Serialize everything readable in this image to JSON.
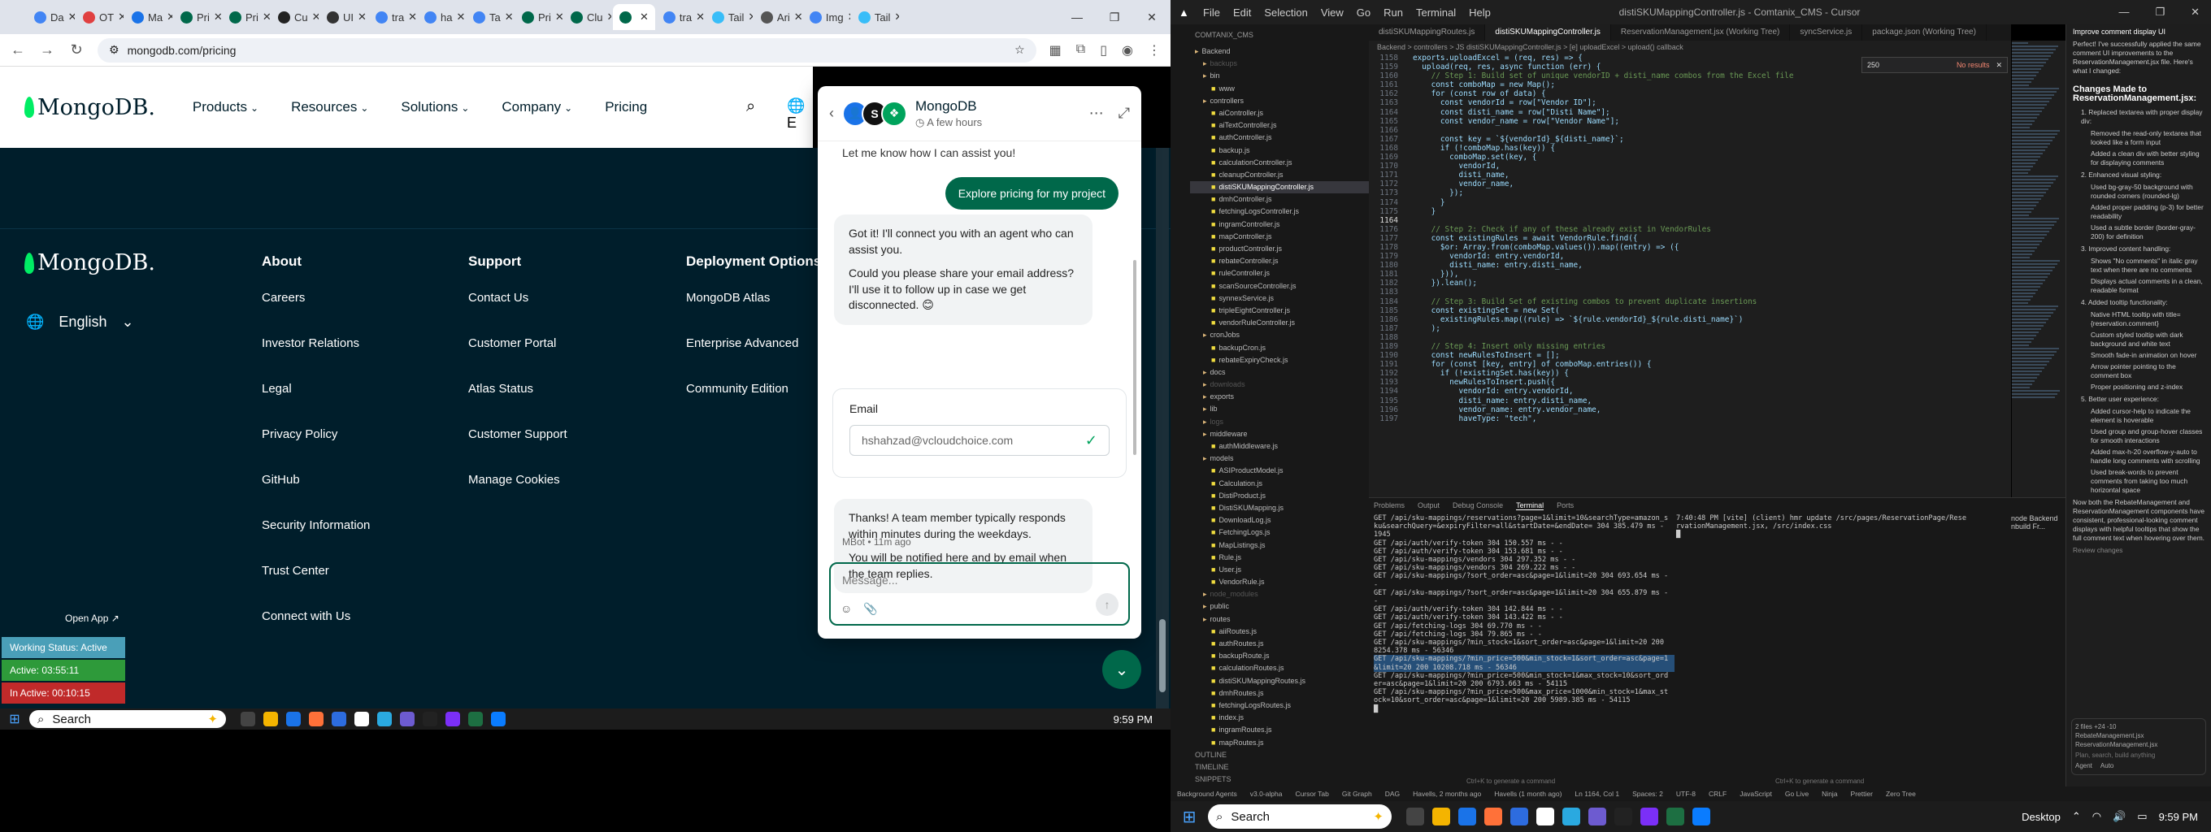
{
  "browser": {
    "tabs": [
      {
        "label": "Da",
        "color": "#4285f4"
      },
      {
        "label": "OT",
        "color": "#e04040"
      },
      {
        "label": "Ma",
        "color": "#1a73e8"
      },
      {
        "label": "Pri",
        "color": "#00684a"
      },
      {
        "label": "Pri",
        "color": "#00684a"
      },
      {
        "label": "Cu",
        "color": "#222222"
      },
      {
        "label": "UI",
        "color": "#333333"
      },
      {
        "label": "tra",
        "color": "#4285f4"
      },
      {
        "label": "ha",
        "color": "#4285f4"
      },
      {
        "label": "Ta",
        "color": "#4285f4"
      },
      {
        "label": "Pri",
        "color": "#00684a"
      },
      {
        "label": "Clu",
        "color": "#00684a"
      },
      {
        "label": "",
        "color": "#00684a"
      },
      {
        "label": "tra",
        "color": "#4285f4"
      },
      {
        "label": "Tail",
        "color": "#38bdf8"
      },
      {
        "label": "Ari",
        "color": "#555555"
      },
      {
        "label": "Img",
        "color": "#4285f4"
      },
      {
        "label": "Tail",
        "color": "#38bdf8"
      }
    ],
    "url": "mongodb.com/pricing"
  },
  "site": {
    "logo": "MongoDB.",
    "nav": [
      "Products",
      "Resources",
      "Solutions",
      "Company",
      "Pricing"
    ],
    "nav_lang": "E",
    "footer_lang": "English",
    "columns": [
      {
        "title": "About",
        "items": [
          "Careers",
          "Investor Relations",
          "Legal",
          "Privacy Policy",
          "GitHub",
          "Security Information",
          "Trust Center",
          "Connect with Us"
        ]
      },
      {
        "title": "Support",
        "items": [
          "Contact Us",
          "Customer Portal",
          "Atlas Status",
          "Customer Support",
          "Manage Cookies"
        ]
      },
      {
        "title": "Deployment Options",
        "items": [
          "MongoDB Atlas",
          "Enterprise Advanced",
          "Community Edition"
        ]
      }
    ]
  },
  "chat": {
    "title": "MongoDB",
    "subtitle": "A few hours",
    "avatar_letter": "S",
    "cut_text": "Let me know how I can assist you!",
    "user_message": "Explore pricing for my project",
    "bot_message_1a": "Got it! I'll connect you with an agent who can assist you.",
    "bot_message_1b": "Could you please share your email address? I'll use it to follow up in case we get disconnected. 😊",
    "email_label": "Email",
    "email_value": "hshahzad@vcloudchoice.com",
    "bot_message_2a": "Thanks! A team member typically responds within minutes during the weekdays.",
    "bot_message_2b": "You will be notified here and by email when the team replies.",
    "meta": "MBot • 11m ago",
    "input_placeholder": "Message..."
  },
  "overlay": {
    "open_app": "Open App ↗",
    "working": "Working Status: Active",
    "active": "Active: 03:55:11",
    "inactive": "In Active: 00:10:15",
    "working_color": "#4a9fb8",
    "active_color": "#2e9a3a",
    "inactive_color": "#c02a2a"
  },
  "taskbar": {
    "search": "Search",
    "time_left": "9:59 PM",
    "time_right": "9:59 PM",
    "desktop": "Desktop"
  },
  "ide": {
    "menu": [
      "File",
      "Edit",
      "Selection",
      "View",
      "Go",
      "Run",
      "Terminal",
      "Help"
    ],
    "title": "distiSKUMappingController.js - Comtanix_CMS - Cursor",
    "tabs": [
      "distiSKUMappingRoutes.js",
      "distiSKUMappingController.js",
      "ReservationManagement.jsx (Working Tree)",
      "syncService.js",
      "package.json (Working Tree)"
    ],
    "breadcrumb": "Backend > controllers > JS distiSKUMappingController.js > [e] uploadExcel > upload() callback",
    "find_value": "250",
    "find_result": "No results",
    "explorer_header": "COMTANIX_CMS",
    "files": [
      "Backend",
      "backups",
      "bin",
      "www",
      "controllers",
      "aiController.js",
      "aiTextController.js",
      "authController.js",
      "backup.js",
      "calculationController.js",
      "cleanupController.js",
      "distiSKUMappingController.js",
      "dmhController.js",
      "fetchingLogsController.js",
      "ingramController.js",
      "mapController.js",
      "productController.js",
      "rebateController.js",
      "ruleController.js",
      "scanSourceController.js",
      "synnexService.js",
      "tripleEightController.js",
      "vendorRuleController.js",
      "cronJobs",
      "backupCron.js",
      "rebateExpiryCheck.js",
      "docs",
      "downloads",
      "exports",
      "lib",
      "logs",
      "middleware",
      "authMiddleware.js",
      "models",
      "ASIProductModel.js",
      "Calculation.js",
      "DistiProduct.js",
      "DistiSKUMapping.js",
      "DownloadLog.js",
      "FetchingLogs.js",
      "MapListings.js",
      "Rule.js",
      "User.js",
      "VendorRule.js",
      "node_modules",
      "public",
      "routes",
      "aiiRoutes.js",
      "authRoutes.js",
      "backupRoute.js",
      "calculationRoutes.js",
      "distiSKUMappingRoutes.js",
      "dmhRoutes.js",
      "fetchingLogsRoutes.js",
      "index.js",
      "ingramRoutes.js",
      "mapRoutes.js"
    ],
    "selected_file": "distiSKUMappingController.js",
    "outline": "OUTLINE",
    "timeline": "TIMELINE",
    "snippets": "SNIPPETS",
    "code": [
      {
        "n": "1158",
        "t": "exports.uploadExcel = (req, res) => {",
        "k": "t"
      },
      {
        "n": "1159",
        "t": "  upload(req, res, async function (err) {",
        "k": "t"
      },
      {
        "n": "1160",
        "t": "    // Step 1: Build set of unique vendorID + disti_name combos from the Excel file",
        "k": "c"
      },
      {
        "n": "1161",
        "t": "    const comboMap = new Map();",
        "k": "t"
      },
      {
        "n": "1162",
        "t": "    for (const row of data) {",
        "k": "t"
      },
      {
        "n": "1163",
        "t": "      const vendorId = row[\"Vendor ID\"];",
        "k": "t"
      },
      {
        "n": "1164",
        "t": "      const disti_name = row[\"Disti Name\"];",
        "k": "t"
      },
      {
        "n": "1165",
        "t": "      const vendor_name = row[\"Vendor Name\"];",
        "k": "t"
      },
      {
        "n": "1166",
        "t": "",
        "k": "t"
      },
      {
        "n": "1167",
        "t": "      const key = `${vendorId}_${disti_name}`;",
        "k": "t"
      },
      {
        "n": "1168",
        "t": "      if (!comboMap.has(key)) {",
        "k": "t"
      },
      {
        "n": "1169",
        "t": "        comboMap.set(key, {",
        "k": "t"
      },
      {
        "n": "1170",
        "t": "          vendorId,",
        "k": "t"
      },
      {
        "n": "1171",
        "t": "          disti_name,",
        "k": "t"
      },
      {
        "n": "1172",
        "t": "          vendor_name,",
        "k": "t"
      },
      {
        "n": "1173",
        "t": "        });",
        "k": "t"
      },
      {
        "n": "1174",
        "t": "      }",
        "k": "t"
      },
      {
        "n": "1175",
        "t": "    }",
        "k": "t"
      },
      {
        "n": "1164",
        "t": "",
        "k": "cur"
      },
      {
        "n": "1176",
        "t": "    // Step 2: Check if any of these already exist in VendorRules",
        "k": "c"
      },
      {
        "n": "1177",
        "t": "    const existingRules = await VendorRule.find({",
        "k": "t"
      },
      {
        "n": "1178",
        "t": "      $or: Array.from(comboMap.values()).map((entry) => ({",
        "k": "t"
      },
      {
        "n": "1179",
        "t": "        vendorId: entry.vendorId,",
        "k": "t"
      },
      {
        "n": "1180",
        "t": "        disti_name: entry.disti_name,",
        "k": "t"
      },
      {
        "n": "1181",
        "t": "      })),",
        "k": "t"
      },
      {
        "n": "1182",
        "t": "    }).lean();",
        "k": "t"
      },
      {
        "n": "1183",
        "t": "",
        "k": "t"
      },
      {
        "n": "1184",
        "t": "    // Step 3: Build Set of existing combos to prevent duplicate insertions",
        "k": "c"
      },
      {
        "n": "1185",
        "t": "    const existingSet = new Set(",
        "k": "t"
      },
      {
        "n": "1186",
        "t": "      existingRules.map((rule) => `${rule.vendorId}_${rule.disti_name}`)",
        "k": "t"
      },
      {
        "n": "1187",
        "t": "    );",
        "k": "t"
      },
      {
        "n": "1188",
        "t": "",
        "k": "t"
      },
      {
        "n": "1189",
        "t": "    // Step 4: Insert only missing entries",
        "k": "c"
      },
      {
        "n": "1190",
        "t": "    const newRulesToInsert = [];",
        "k": "t"
      },
      {
        "n": "1191",
        "t": "    for (const [key, entry] of comboMap.entries()) {",
        "k": "t"
      },
      {
        "n": "1192",
        "t": "      if (!existingSet.has(key)) {",
        "k": "t"
      },
      {
        "n": "1193",
        "t": "        newRulesToInsert.push({",
        "k": "t"
      },
      {
        "n": "1194",
        "t": "          vendorId: entry.vendorId,",
        "k": "t"
      },
      {
        "n": "1195",
        "t": "          disti_name: entry.disti_name,",
        "k": "t"
      },
      {
        "n": "1196",
        "t": "          vendor_name: entry.vendor_name,",
        "k": "t"
      },
      {
        "n": "1197",
        "t": "          haveType: \"tech\",",
        "k": "t"
      }
    ],
    "panel_tabs": [
      "Problems",
      "Output",
      "Debug Console",
      "Terminal",
      "Ports"
    ],
    "term_left": [
      "GET /api/sku-mappings/reservations?page=1&limit=10&searchType=amazon_s",
      "ku&searchQuery=&expiryFilter=all&startDate=&endDate= 304 385.479 ms -",
      "1945",
      "GET /api/auth/verify-token 304 150.557 ms - -",
      "GET /api/auth/verify-token 304 153.681 ms - -",
      "GET /api/sku-mappings/vendors 304 297.352 ms - -",
      "GET /api/sku-mappings/vendors 304 269.222 ms - -",
      "GET /api/sku-mappings/?sort_order=asc&page=1&limit=20 304 693.654 ms -",
      "-",
      "GET /api/sku-mappings/?sort_order=asc&page=1&limit=20 304 655.879 ms -",
      "-",
      "GET /api/auth/verify-token 304 142.844 ms - -",
      "GET /api/auth/verify-token 304 143.422 ms - -",
      "GET /api/fetching-logs 304 69.770 ms - -",
      "GET /api/fetching-logs 304 79.865 ms - -",
      "GET /api/sku-mappings/?min_stock=1&sort_order=asc&page=1&limit=20 200",
      "8254.378 ms - 56346",
      "GET /api/sku-mappings/?min_price=500&min_stock=1&sort_order=asc&page=1",
      "&limit=20 200 10208.718 ms - 56346",
      "GET /api/sku-mappings/?min_price=500&min_stock=1&max_stock=10&sort_ord",
      "er=asc&page=1&limit=20 200 6793.663 ms - 54115",
      "GET /api/sku-mappings/?min_price=500&max_price=1000&min_stock=1&max_st",
      "ock=10&sort_order=asc&page=1&limit=20 200 5989.385 ms - 54115",
      "█"
    ],
    "term_right": [
      "7:40:48 PM [vite] (client) hmr update /src/pages/ReservationPage/Rese",
      "rvationManagement.jsx, /src/index.css",
      "█"
    ],
    "term_list": [
      "node Backend",
      "nbuild Fr..."
    ],
    "hint_left": "Ctrl+K to generate a command",
    "hint_right": "Ctrl+K to generate a command",
    "statusbar": [
      "Background Agents",
      "v3.0-alpha",
      "Cursor Tab",
      "Git Graph",
      "DAG",
      "Havells, 2 months ago",
      "Havells (1 month ago)",
      "Ln 1164, Col 1",
      "Spaces: 2",
      "UTF-8",
      "CRLF",
      "JavaScript",
      "Go Live",
      "Ninja",
      "Prettier",
      "Zero Tree"
    ],
    "side": {
      "header": "Improve comment display UI",
      "intro": "Perfect! I've successfully applied the same comment UI improvements to the ReservationManagement.jsx file. Here's what I changed:",
      "h": "Changes Made to ReservationManagement.jsx:",
      "items": [
        {
          "t": "1. Replaced textarea with proper display div:",
          "subs": [
            "Removed the read-only textarea that looked like a form input",
            "Added a clean div with better styling for displaying comments"
          ]
        },
        {
          "t": "2. Enhanced visual styling:",
          "subs": [
            "Used bg-gray-50 background with rounded corners (rounded-lg)",
            "Added proper padding (p-3) for better readability",
            "Used a subtle border (border-gray-200) for definition"
          ]
        },
        {
          "t": "3. Improved content handling:",
          "subs": [
            "Shows \"No comments\" in italic gray text when there are no comments",
            "Displays actual comments in a clean, readable format"
          ]
        },
        {
          "t": "4. Added tooltip functionality:",
          "subs": [
            "Native HTML tooltip with title={reservation.comment}",
            "Custom styled tooltip with dark background and white text",
            "Smooth fade-in animation on hover",
            "Arrow pointer pointing to the comment box",
            "Proper positioning and z-index"
          ]
        },
        {
          "t": "5. Better user experience:",
          "subs": [
            "Added cursor-help to indicate the element is hoverable",
            "Used group and group-hover classes for smooth interactions",
            "Added max-h-20 overflow-y-auto to handle long comments with scrolling",
            "Used break-words to prevent comments from taking too much horizontal space"
          ]
        }
      ],
      "outro": "Now both the RebateManagement and ReservationManagement components have consistent, professional-looking comment displays with helpful tooltips that show the full comment text when hovering over them.",
      "review": "Review changes",
      "box_files": [
        "2 files +24 -10",
        "RebateManagement.jsx",
        "ReservationManagement.jsx"
      ],
      "box_hint": "Plan, search, build anything",
      "agent": "Agent",
      "mode": "Auto"
    }
  }
}
